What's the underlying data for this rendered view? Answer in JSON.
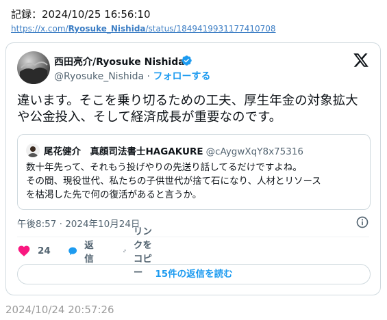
{
  "record": {
    "label": "記録：2024/10/25 16:56:10"
  },
  "source_url": {
    "prefix": "https://x.com/",
    "user": "Ryosuke_Nishida",
    "suffix": "/status/1849419931177410708"
  },
  "tweet": {
    "author_name": "西田亮介/Ryosuke Nishida",
    "handle": "@Ryosuke_Nishida",
    "separator": " · ",
    "follow_label": "フォローする",
    "text": "違います。そこを乗り切るための工夫、厚生年金の対象拡大や公金投入、そして経済成長が重要なのです。",
    "timestamp": "午後8:57 · 2024年10月24日"
  },
  "quote": {
    "author_name": "尾花健介　真顔司法書士HAGAKURE",
    "handle": "@cAygwXqY8x75316",
    "text_lines": [
      "数十年先って、それもう投げやりの先送り話してるだけですよね。",
      "その間、現役世代、私たちの子供世代が捨て石になり、人材とリソース",
      "を枯渇した先で何の復活があると言うか。"
    ]
  },
  "actions": {
    "like_count": "24",
    "reply_label": "返信",
    "copy_label": "リンクをコピー"
  },
  "replies_button": {
    "label": "15件の返信を読む"
  },
  "footer": {
    "time": "2024/10/24 20:57:26"
  },
  "colors": {
    "accent": "#1d9bf0",
    "like": "#f91880",
    "muted": "#536471",
    "border": "#cfd9de"
  },
  "icons": {
    "verified": "verified-badge-icon",
    "brand": "x-logo-icon",
    "info": "info-icon",
    "like": "heart-icon",
    "reply": "speech-bubble-icon",
    "copy": "link-icon"
  }
}
